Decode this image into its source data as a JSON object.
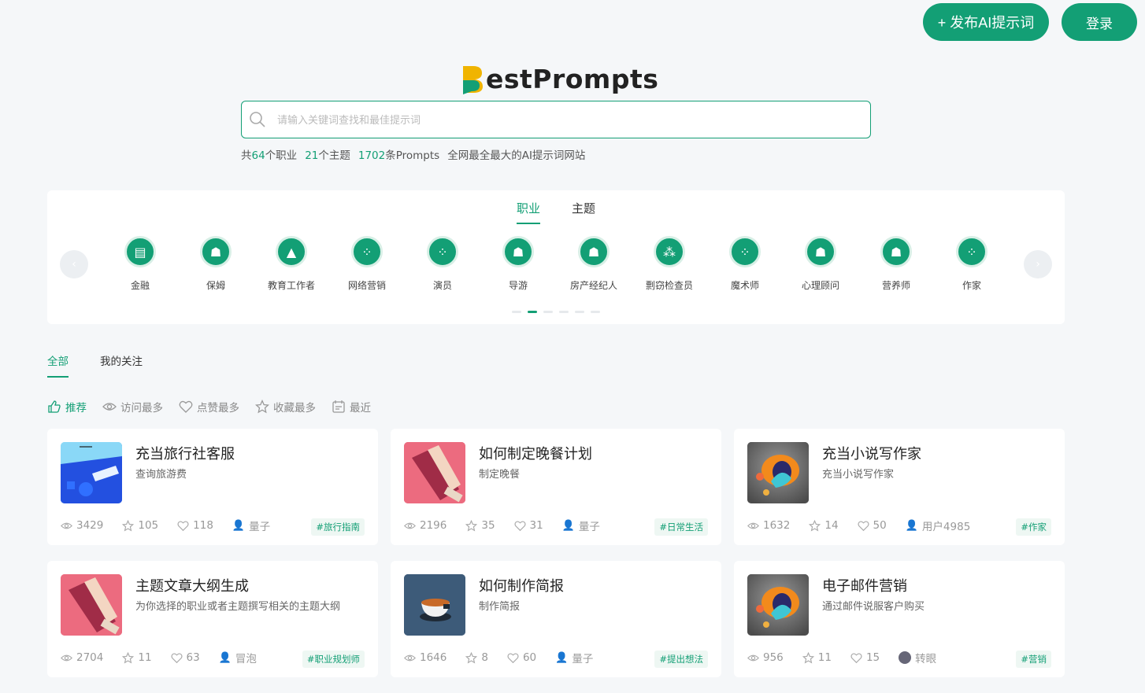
{
  "header": {
    "publish_label": "+ 发布AI提示词",
    "login_label": "登录"
  },
  "logo": {
    "text": "estPrompts",
    "mark": "B"
  },
  "search": {
    "placeholder": "请输入关键词查找和最佳提示词"
  },
  "stats": {
    "prefix1": "共",
    "jobs_count": "64",
    "jobs_suffix": "个职业",
    "topics_count": "21",
    "topics_suffix": "个主题",
    "prompts_count": "1702",
    "prompts_suffix": "条Prompts",
    "slogan": "全网最全最大的AI提示词网站"
  },
  "panel": {
    "tabs": [
      {
        "label": "职业",
        "active": true
      },
      {
        "label": "主题",
        "active": false
      }
    ],
    "jobs": [
      {
        "label": "金融",
        "icon": "finance-icon"
      },
      {
        "label": "保姆",
        "icon": "hand-person-icon"
      },
      {
        "label": "教育工作者",
        "icon": "graduation-cap-icon"
      },
      {
        "label": "网络营销",
        "icon": "dots-icon"
      },
      {
        "label": "演员",
        "icon": "dots-icon"
      },
      {
        "label": "导游",
        "icon": "hand-person-icon"
      },
      {
        "label": "房产经纪人",
        "icon": "hand-person-icon"
      },
      {
        "label": "剽窃检查员",
        "icon": "group-icon"
      },
      {
        "label": "魔术师",
        "icon": "dots-icon"
      },
      {
        "label": "心理顾问",
        "icon": "hand-person-icon"
      },
      {
        "label": "营养师",
        "icon": "hand-person-icon"
      },
      {
        "label": "作家",
        "icon": "dots-icon"
      }
    ]
  },
  "filter_tabs": [
    {
      "label": "全部",
      "active": true
    },
    {
      "label": "我的关注",
      "active": false
    }
  ],
  "sorts": [
    {
      "label": "推荐",
      "icon": "thumbs-up-icon",
      "active": true
    },
    {
      "label": "访问最多",
      "icon": "eye-icon",
      "active": false
    },
    {
      "label": "点赞最多",
      "icon": "heart-icon",
      "active": false
    },
    {
      "label": "收藏最多",
      "icon": "star-icon",
      "active": false
    },
    {
      "label": "最近",
      "icon": "calendar-icon",
      "active": false
    }
  ],
  "cards": [
    {
      "title": "充当旅行社客服",
      "desc": "查询旅游费",
      "views": "3429",
      "stars": "105",
      "likes": "118",
      "user": "量子",
      "tag": "#旅行指南",
      "thumb": "travel"
    },
    {
      "title": "如何制定晚餐计划",
      "desc": "制定晚餐",
      "views": "2196",
      "stars": "35",
      "likes": "31",
      "user": "量子",
      "tag": "#日常生活",
      "thumb": "pink"
    },
    {
      "title": "充当小说写作家",
      "desc": "充当小说写作家",
      "views": "1632",
      "stars": "14",
      "likes": "50",
      "user": "用户4985",
      "tag": "#作家",
      "thumb": "orange"
    },
    {
      "title": "主题文章大纲生成",
      "desc": "为你选择的职业或者主题撰写相关的主题大纲",
      "views": "2704",
      "stars": "11",
      "likes": "63",
      "user": "冒泡",
      "tag": "#职业规划师",
      "thumb": "pink"
    },
    {
      "title": "如何制作简报",
      "desc": "制作简报",
      "views": "1646",
      "stars": "8",
      "likes": "60",
      "user": "量子",
      "tag": "#提出想法",
      "thumb": "cup"
    },
    {
      "title": "电子邮件营销",
      "desc": "通过邮件说服客户购买",
      "views": "956",
      "stars": "11",
      "likes": "15",
      "user": "转眼",
      "tag": "#营销",
      "thumb": "orange",
      "avatar": true
    }
  ],
  "colors": {
    "accent": "#139f75",
    "background": "#f5f7f9"
  }
}
